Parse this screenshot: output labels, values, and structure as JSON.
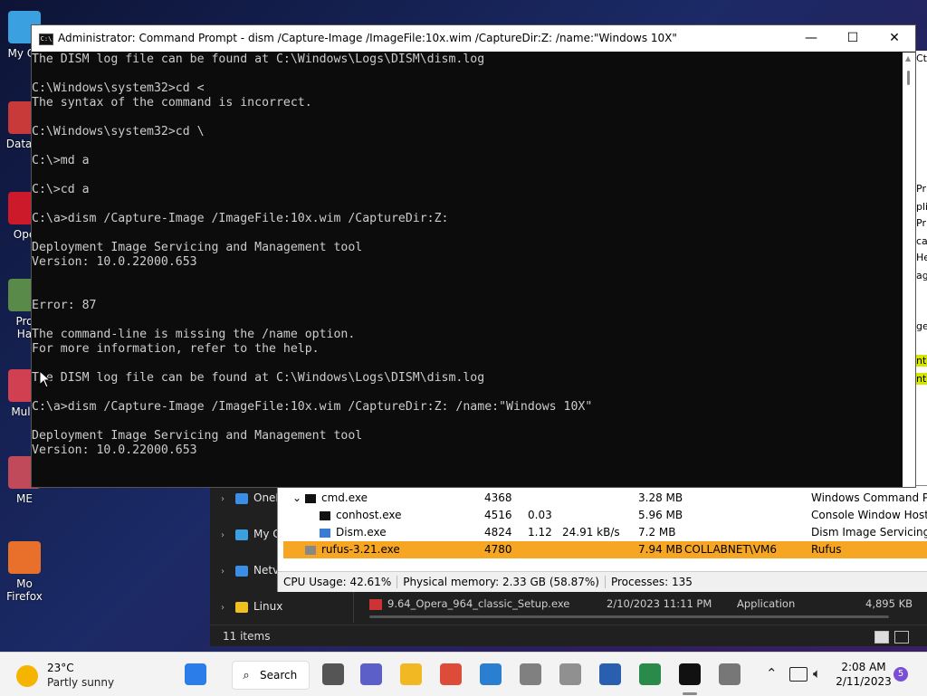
{
  "desktop": {
    "icons": [
      {
        "label": "My Co",
        "name": "my-computer",
        "color": "#3aa0e0"
      },
      {
        "label": "DataW",
        "name": "datawizard",
        "color": "#c83a3a"
      },
      {
        "label": "Ope",
        "name": "opera",
        "color": "#cc1a2a"
      },
      {
        "label": "Pro\nHa",
        "name": "pro-hardware",
        "color": "#5a8a4a"
      },
      {
        "label": "Multi",
        "name": "multi",
        "color": "#d04050"
      },
      {
        "label": "ME",
        "name": "me",
        "color": "#c04a5a"
      },
      {
        "label": "Mo\nFirefox",
        "name": "firefox",
        "color": "#e8702a"
      }
    ]
  },
  "cmd": {
    "title": "Administrator:  Command Prompt - dism  /Capture-Image /ImageFile:10x.wim /CaptureDir:Z: /name:\"Windows 10X\"",
    "icon_text": "C:\\",
    "minimize": "—",
    "maximize": "☐",
    "close": "✕",
    "lines": [
      "The DISM log file can be found at C:\\Windows\\Logs\\DISM\\dism.log",
      "",
      "C:\\Windows\\system32>cd <",
      "The syntax of the command is incorrect.",
      "",
      "C:\\Windows\\system32>cd \\",
      "",
      "C:\\>md a",
      "",
      "C:\\>cd a",
      "",
      "C:\\a>dism /Capture-Image /ImageFile:10x.wim /CaptureDir:Z:",
      "",
      "Deployment Image Servicing and Management tool",
      "Version: 10.0.22000.653",
      "",
      "",
      "Error: 87",
      "",
      "The command-line is missing the /name option.",
      "For more information, refer to the help.",
      "",
      "The DISM log file can be found at C:\\Windows\\Logs\\DISM\\dism.log",
      "",
      "C:\\a>dism /Capture-Image /ImageFile:10x.wim /CaptureDir:Z: /name:\"Windows 10X\"",
      "",
      "Deployment Image Servicing and Management tool",
      "Version: 10.0.22000.653"
    ]
  },
  "explorer": {
    "nav": [
      {
        "label": "OneI",
        "icon": "cloud-icon",
        "color": "#3a8ee6"
      },
      {
        "label": "My C",
        "icon": "computer-icon",
        "color": "#3aa0e0"
      },
      {
        "label": "Netv",
        "icon": "network-icon",
        "color": "#3a8ee6"
      },
      {
        "label": "Linux",
        "icon": "penguin-icon",
        "color": "#f0c020"
      }
    ],
    "file_row": {
      "name": "9.64_Opera_964_classic_Setup.exe",
      "date": "2/10/2023 11:11 PM",
      "type": "Application",
      "size": "4,895 KB"
    },
    "item_count": "11 items"
  },
  "taskmgr": {
    "rows": [
      {
        "name": "cmd.exe",
        "pid": "4368",
        "cpu": "",
        "io": "",
        "mem": "3.28 MB",
        "user": "",
        "desc": "Windows Command Pro",
        "expand": "⌄",
        "selected": false,
        "indent": 0
      },
      {
        "name": "conhost.exe",
        "pid": "4516",
        "cpu": "0.03",
        "io": "",
        "mem": "5.96 MB",
        "user": "",
        "desc": "Console Window Host",
        "expand": "",
        "selected": false,
        "indent": 1
      },
      {
        "name": "Dism.exe",
        "pid": "4824",
        "cpu": "1.12",
        "io": "24.91 kB/s",
        "mem": "7.2 MB",
        "user": "",
        "desc": "Dism Image Servicing Ut",
        "expand": "",
        "selected": false,
        "indent": 1
      },
      {
        "name": "rufus-3.21.exe",
        "pid": "4780",
        "cpu": "",
        "io": "",
        "mem": "7.94 MB",
        "user": "COLLABNET\\VM6",
        "desc": "Rufus",
        "expand": "",
        "selected": true,
        "indent": 0
      }
    ],
    "status": {
      "cpu": "CPU Usage: 42.61%",
      "memory": "Physical memory: 2.33 GB (58.87%)",
      "processes": "Processes: 135"
    },
    "selected_color": "#f6a623"
  },
  "right_partial": [
    "Ct",
    "Pr",
    "pli",
    "Pr",
    "ca",
    "He",
    "ag",
    "ge",
    "nt",
    "nt"
  ],
  "taskbar": {
    "weather": {
      "temp": "23°C",
      "condition": "Partly sunny"
    },
    "search_label": "Search",
    "apps": [
      {
        "name": "start-icon",
        "color": "#2b7de9"
      },
      {
        "name": "task-view-icon",
        "color": "#555555"
      },
      {
        "name": "chat-icon",
        "color": "#5b5fc7"
      },
      {
        "name": "file-explorer-icon",
        "color": "#f2b824"
      },
      {
        "name": "chrome-icon",
        "color": "#dd4b39"
      },
      {
        "name": "rdp-icon",
        "color": "#2a7fd0"
      },
      {
        "name": "vm-icon",
        "color": "#808080"
      },
      {
        "name": "vm2-icon",
        "color": "#909090"
      },
      {
        "name": "powershell-icon",
        "color": "#2a5fb0"
      },
      {
        "name": "task-manager-icon",
        "color": "#2a8a4a"
      },
      {
        "name": "terminal-icon",
        "color": "#111111"
      },
      {
        "name": "usb-icon",
        "color": "#777777"
      }
    ],
    "time": "2:08 AM",
    "date": "2/11/2023",
    "notification_count": "5"
  }
}
